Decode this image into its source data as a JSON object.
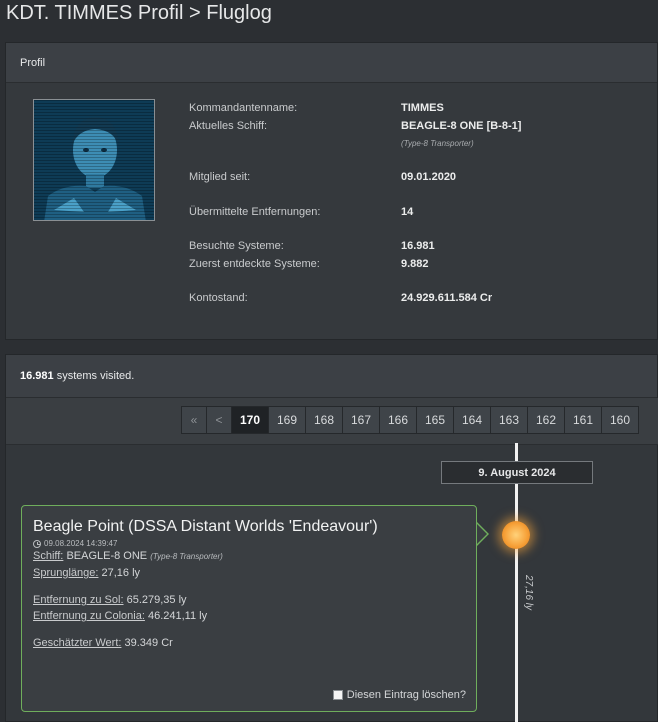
{
  "page": {
    "title": "KDT. TIMMES Profil > Fluglog"
  },
  "profile": {
    "header": "Profil",
    "avatar_icon": "commander-portrait",
    "rows": {
      "cmdr_label": "Kommandantenname:",
      "cmdr_value": "TIMMES",
      "ship_label": "Aktuelles Schiff:",
      "ship_value": "BEAGLE-8 ONE [B-8-1]",
      "ship_type": "(Type-8 Transporter)",
      "member_label": "Mitglied seit:",
      "member_value": "09.01.2020",
      "dist_label": "Übermittelte Entfernungen:",
      "dist_value": "14",
      "visited_label": "Besuchte Systeme:",
      "visited_value": "16.981",
      "first_label": "Zuerst entdeckte Systeme:",
      "first_value": "9.882",
      "credits_label": "Kontostand:",
      "credits_value": "24.929.611.584 Cr"
    }
  },
  "systems": {
    "count": "16.981",
    "count_suffix": "systems visited.",
    "pager": {
      "first": "«",
      "prev": "<",
      "pages": [
        "170",
        "169",
        "168",
        "167",
        "166",
        "165",
        "164",
        "163",
        "162",
        "161",
        "160"
      ],
      "active": "170"
    },
    "timeline": {
      "date": "9. August 2024",
      "jump": "27,16 ly"
    },
    "entry": {
      "title": "Beagle Point (DSSA Distant Worlds 'Endeavour')",
      "time": "09.08.2024 14:39:47",
      "ship_label": "Schiff:",
      "ship_value": "BEAGLE-8 ONE",
      "ship_type": "(Type-8 Transporter)",
      "jump_label": "Sprunglänge:",
      "jump_value": "27,16 ly",
      "sol_label": "Entfernung zu Sol:",
      "sol_value": "65.279,35 ly",
      "colonia_label": "Entfernung zu Colonia:",
      "colonia_value": "46.241,11 ly",
      "value_label": "Geschätzter Wert:",
      "value_value": "39.349 Cr",
      "delete_label": "Diesen Eintrag löschen?"
    }
  }
}
